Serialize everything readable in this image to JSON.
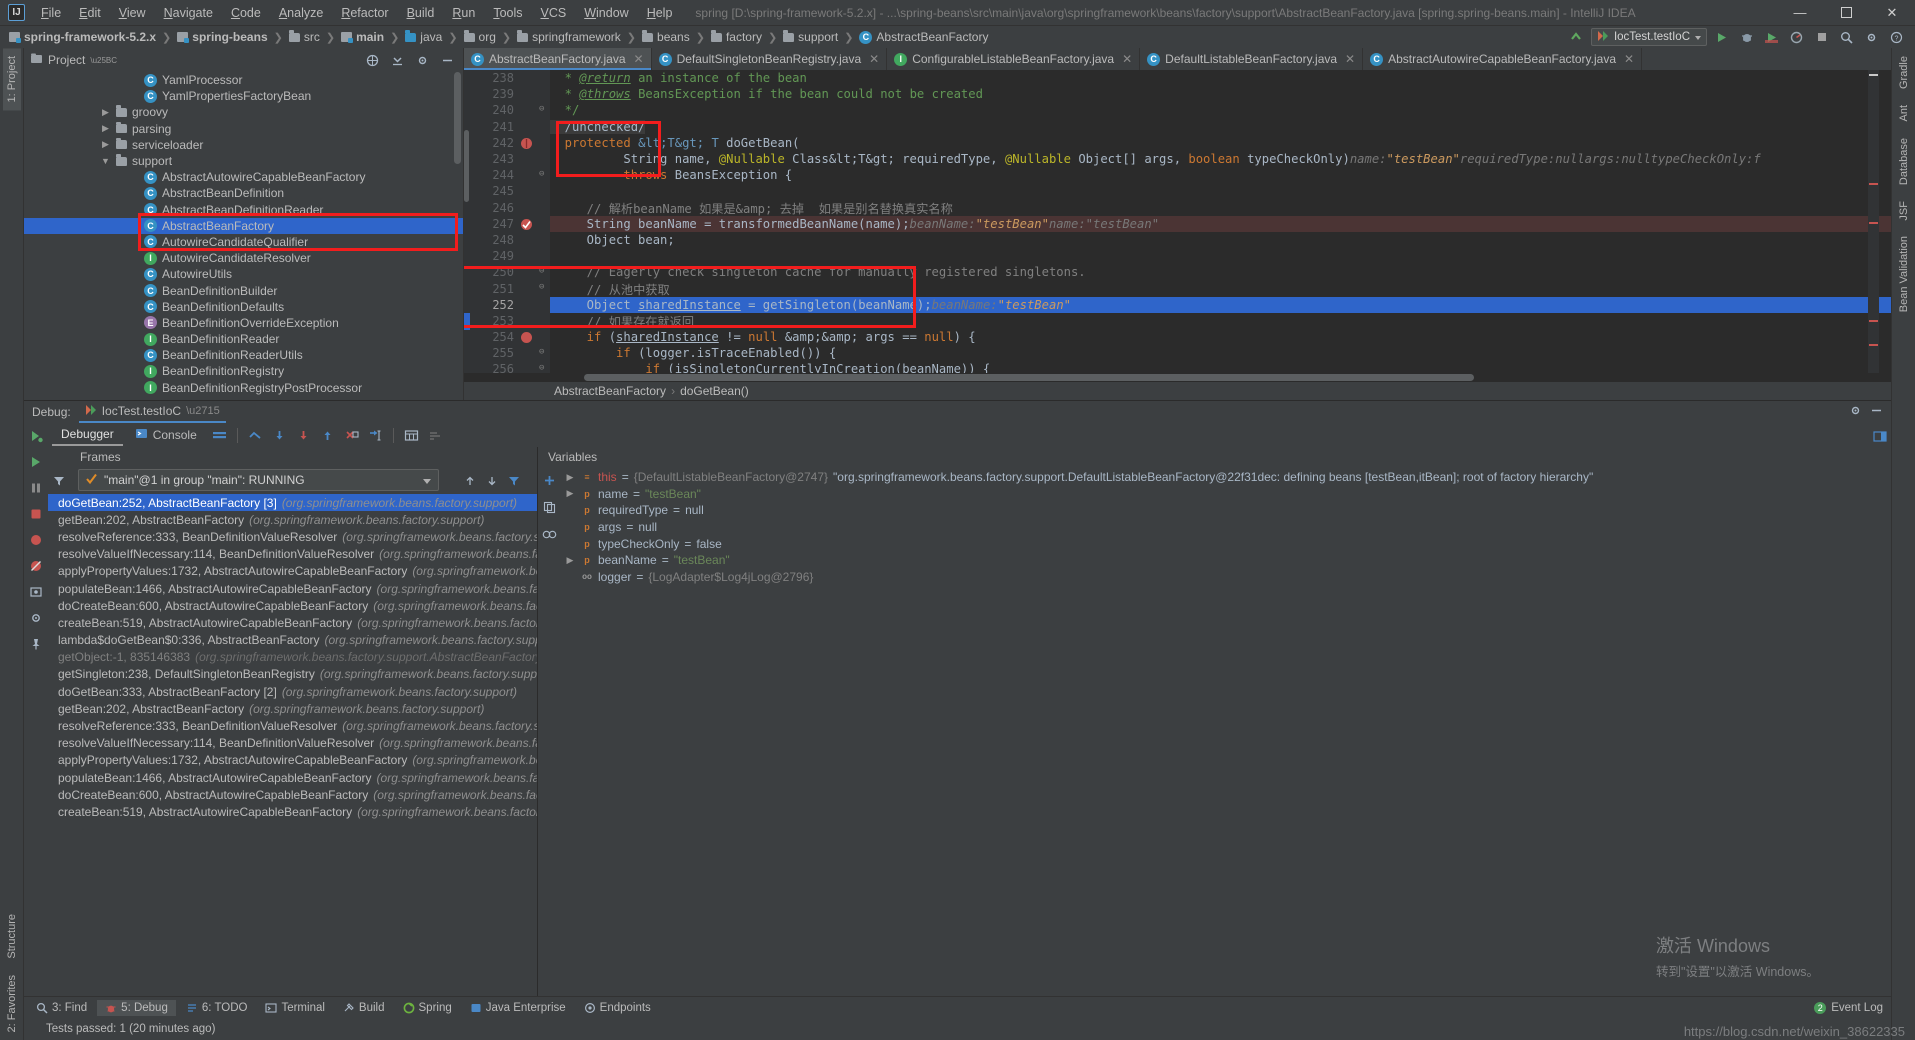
{
  "titlebar": {
    "logo": "IJ",
    "menus": [
      "File",
      "Edit",
      "View",
      "Navigate",
      "Code",
      "Analyze",
      "Refactor",
      "Build",
      "Run",
      "Tools",
      "VCS",
      "Window",
      "Help"
    ],
    "window_title": "spring [D:\\spring-framework-5.2.x] - ...\\spring-beans\\src\\main\\java\\org\\springframework\\beans\\factory\\support\\AbstractBeanFactory.java [spring.spring-beans.main] - IntelliJ IDEA",
    "minimize": "—",
    "maximize": "☐",
    "close": "✕"
  },
  "navbar": {
    "crumbs": [
      {
        "label": "spring-framework-5.2.x",
        "icon": "module-icon",
        "bold": true
      },
      {
        "label": "spring-beans",
        "icon": "module-icon",
        "bold": true
      },
      {
        "label": "src",
        "icon": "folder-icon",
        "bold": false
      },
      {
        "label": "main",
        "icon": "module-icon",
        "bold": true
      },
      {
        "label": "java",
        "icon": "folder-blue-icon",
        "bold": false
      },
      {
        "label": "org",
        "icon": "folder-icon",
        "bold": false
      },
      {
        "label": "springframework",
        "icon": "folder-icon",
        "bold": false
      },
      {
        "label": "beans",
        "icon": "folder-icon",
        "bold": false
      },
      {
        "label": "factory",
        "icon": "folder-icon",
        "bold": false
      },
      {
        "label": "support",
        "icon": "folder-icon",
        "bold": false
      },
      {
        "label": "AbstractBeanFactory",
        "icon": "class-icon",
        "bold": false
      }
    ],
    "separator": "❯",
    "run_config": "IocTest.testIoC",
    "run_label": "Run",
    "debug_label": "Debug",
    "coverage_label": "Run with Coverage",
    "profiler_label": "Profiler",
    "stop_label": "Stop",
    "search_label": "Search Everywhere"
  },
  "left_strip": {
    "project_tab": "1: Project",
    "structure_tab": "Structure",
    "favorites_tab": "2: Favorites"
  },
  "right_strip": {
    "gradle_tab": "Gradle",
    "ant_tab": "Ant",
    "database_tab": "Database",
    "jsf_tab": "JSF",
    "bean_validation_tab": "Bean Validation"
  },
  "project_pane": {
    "title": "Project",
    "tree": [
      {
        "label": "YamlProcessor",
        "icon": "class-icon",
        "indent": 7,
        "arrow": "",
        "selected": false
      },
      {
        "label": "YamlPropertiesFactoryBean",
        "icon": "class-icon",
        "indent": 7,
        "arrow": "",
        "selected": false
      },
      {
        "label": "groovy",
        "icon": "folder-icon",
        "indent": 5,
        "arrow": "▶",
        "selected": false
      },
      {
        "label": "parsing",
        "icon": "folder-icon",
        "indent": 5,
        "arrow": "▶",
        "selected": false
      },
      {
        "label": "serviceloader",
        "icon": "folder-icon",
        "indent": 5,
        "arrow": "▶",
        "selected": false
      },
      {
        "label": "support",
        "icon": "folder-icon",
        "indent": 5,
        "arrow": "▼",
        "selected": false
      },
      {
        "label": "AbstractAutowireCapableBeanFactory",
        "icon": "class-icon",
        "indent": 7,
        "arrow": "",
        "selected": false
      },
      {
        "label": "AbstractBeanDefinition",
        "icon": "class-icon",
        "indent": 7,
        "arrow": "",
        "selected": false
      },
      {
        "label": "AbstractBeanDefinitionReader",
        "icon": "class-icon",
        "indent": 7,
        "arrow": "",
        "selected": false
      },
      {
        "label": "AbstractBeanFactory",
        "icon": "class-icon",
        "indent": 7,
        "arrow": "",
        "selected": true
      },
      {
        "label": "AutowireCandidateQualifier",
        "icon": "class-icon",
        "indent": 7,
        "arrow": "",
        "selected": false
      },
      {
        "label": "AutowireCandidateResolver",
        "icon": "interface-icon",
        "indent": 7,
        "arrow": "",
        "selected": false
      },
      {
        "label": "AutowireUtils",
        "icon": "class-icon",
        "indent": 7,
        "arrow": "",
        "selected": false
      },
      {
        "label": "BeanDefinitionBuilder",
        "icon": "class-icon",
        "indent": 7,
        "arrow": "",
        "selected": false
      },
      {
        "label": "BeanDefinitionDefaults",
        "icon": "class-icon",
        "indent": 7,
        "arrow": "",
        "selected": false
      },
      {
        "label": "BeanDefinitionOverrideException",
        "icon": "enum-icon",
        "indent": 7,
        "arrow": "",
        "selected": false
      },
      {
        "label": "BeanDefinitionReader",
        "icon": "interface-icon",
        "indent": 7,
        "arrow": "",
        "selected": false
      },
      {
        "label": "BeanDefinitionReaderUtils",
        "icon": "class-icon",
        "indent": 7,
        "arrow": "",
        "selected": false
      },
      {
        "label": "BeanDefinitionRegistry",
        "icon": "interface-icon",
        "indent": 7,
        "arrow": "",
        "selected": false
      },
      {
        "label": "BeanDefinitionRegistryPostProcessor",
        "icon": "interface-icon",
        "indent": 7,
        "arrow": "",
        "selected": false
      }
    ]
  },
  "editor": {
    "tabs": [
      {
        "label": "AbstractBeanFactory.java",
        "icon": "class-icon",
        "active": true
      },
      {
        "label": "DefaultSingletonBeanRegistry.java",
        "icon": "class-icon",
        "active": false
      },
      {
        "label": "ConfigurableListableBeanFactory.java",
        "icon": "interface-icon",
        "active": false
      },
      {
        "label": "DefaultListableBeanFactory.java",
        "icon": "class-icon",
        "active": false
      },
      {
        "label": "AbstractAutowireCapableBeanFactory.java",
        "icon": "class-icon",
        "active": false
      }
    ],
    "breadcrumb": [
      "AbstractBeanFactory",
      "doGetBean()"
    ],
    "breadcrumb_sep": "›",
    "lines": [
      {
        "num": "238",
        "text": " * @return an instance of the bean"
      },
      {
        "num": "239",
        "text": " * @throws BeansException if the bean could not be created"
      },
      {
        "num": "240",
        "text": " */"
      },
      {
        "num": "241",
        "text": "/unchecked/"
      },
      {
        "num": "242",
        "text": "protected <T> T doGetBean("
      },
      {
        "num": "243",
        "text": "        String name, @Nullable Class<T> requiredType, @Nullable Object[] args, boolean typeCheckOnly)"
      },
      {
        "num": "244",
        "text": "        throws BeansException {"
      },
      {
        "num": "245",
        "text": ""
      },
      {
        "num": "246",
        "text": "    // 解析beanName 如果是& 去掉  如果是别名替换真实名称"
      },
      {
        "num": "247",
        "text": "    String beanName = transformedBeanName(name);"
      },
      {
        "num": "248",
        "text": "    Object bean;"
      },
      {
        "num": "249",
        "text": ""
      },
      {
        "num": "250",
        "text": "    // Eagerly check singleton cache for manually registered singletons."
      },
      {
        "num": "251",
        "text": "    // 从池中获取"
      },
      {
        "num": "252",
        "text": "    Object sharedInstance = getSingleton(beanName);"
      },
      {
        "num": "253",
        "text": "    // 如果存在就返回"
      },
      {
        "num": "254",
        "text": "    if (sharedInstance != null && args == null) {"
      },
      {
        "num": "255",
        "text": "        if (logger.isTraceEnabled()) {"
      },
      {
        "num": "256",
        "text": "            if (isSingletonCurrentlyInCreation(beanName)) {"
      }
    ],
    "hints": {
      "l243_name": "name:",
      "l243_name_val": "\"testBean\"",
      "l243_reqtype": "requiredType:",
      "l243_reqtype_val": "null",
      "l243_args": "args:",
      "l243_args_val": "null",
      "l243_typecheck": "typeCheckOnly:",
      "l243_typecheck_val": "f",
      "l247_beanname": "beanName:",
      "l247_beanname_val": "\"testBean\"",
      "l247_name": "name:",
      "l247_name_val": "\"testBean\"",
      "l252_beanname": "beanName:",
      "l252_beanname_val": "\"testBean\""
    }
  },
  "debug_panel": {
    "label": "Debug:",
    "session": "IocTest.testIoC",
    "tabs": [
      {
        "label": "Debugger",
        "active": true
      },
      {
        "label": "Console",
        "active": false
      }
    ],
    "toolbar_titles": [
      "Show Execution Point",
      "Step Over",
      "Step Into",
      "Force Step Into",
      "Step Out",
      "Drop Frame",
      "Run to Cursor",
      "Evaluate Expression",
      "Settings"
    ],
    "frames_header": "Frames",
    "thread": "\"main\"@1 in group \"main\": RUNNING",
    "frames": [
      {
        "method": "doGetBean:252, AbstractBeanFactory",
        "pkg": "(org.springframework.beans.factory.support)",
        "suffix": " [3]",
        "selected": true,
        "dim": false
      },
      {
        "method": "getBean:202, AbstractBeanFactory",
        "pkg": "(org.springframework.beans.factory.support)",
        "suffix": "",
        "selected": false,
        "dim": false
      },
      {
        "method": "resolveReference:333, BeanDefinitionValueResolver",
        "pkg": "(org.springframework.beans.factory.support)",
        "suffix": "",
        "selected": false,
        "dim": false
      },
      {
        "method": "resolveValueIfNecessary:114, BeanDefinitionValueResolver",
        "pkg": "(org.springframework.beans.factory.support)",
        "suffix": "",
        "selected": false,
        "dim": false
      },
      {
        "method": "applyPropertyValues:1732, AbstractAutowireCapableBeanFactory",
        "pkg": "(org.springframework.beans.f",
        "suffix": "",
        "selected": false,
        "dim": false
      },
      {
        "method": "populateBean:1466, AbstractAutowireCapableBeanFactory",
        "pkg": "(org.springframework.beans.factory",
        "suffix": "",
        "selected": false,
        "dim": false
      },
      {
        "method": "doCreateBean:600, AbstractAutowireCapableBeanFactory",
        "pkg": "(org.springframework.beans.factory.",
        "suffix": "",
        "selected": false,
        "dim": false
      },
      {
        "method": "createBean:519, AbstractAutowireCapableBeanFactory",
        "pkg": "(org.springframework.beans.factory.sup",
        "suffix": "",
        "selected": false,
        "dim": false
      },
      {
        "method": "lambda$doGetBean$0:336, AbstractBeanFactory",
        "pkg": "(org.springframework.beans.factory.support)",
        "suffix": "",
        "selected": false,
        "dim": false
      },
      {
        "method": "getObject:-1, 835146383",
        "pkg": "(org.springframework.beans.factory.support.AbstractBeanFactory$$La",
        "suffix": "",
        "selected": false,
        "dim": true
      },
      {
        "method": "getSingleton:238, DefaultSingletonBeanRegistry",
        "pkg": "(org.springframework.beans.factory.support)",
        "suffix": "",
        "selected": false,
        "dim": false
      },
      {
        "method": "doGetBean:333, AbstractBeanFactory",
        "pkg": "(org.springframework.beans.factory.support)",
        "suffix": " [2]",
        "selected": false,
        "dim": false
      },
      {
        "method": "getBean:202, AbstractBeanFactory",
        "pkg": "(org.springframework.beans.factory.support)",
        "suffix": "",
        "selected": false,
        "dim": false
      },
      {
        "method": "resolveReference:333, BeanDefinitionValueResolver",
        "pkg": "(org.springframework.beans.factory.suppor",
        "suffix": "",
        "selected": false,
        "dim": false
      },
      {
        "method": "resolveValueIfNecessary:114, BeanDefinitionValueResolver",
        "pkg": "(org.springframework.beans.factory.su",
        "suffix": "",
        "selected": false,
        "dim": false
      },
      {
        "method": "applyPropertyValues:1732, AbstractAutowireCapableBeanFactory",
        "pkg": "(org.springframework.beans.f",
        "suffix": "",
        "selected": false,
        "dim": false
      },
      {
        "method": "populateBean:1466, AbstractAutowireCapableBeanFactory",
        "pkg": "(org.springframework.beans.factory.",
        "suffix": "",
        "selected": false,
        "dim": false
      },
      {
        "method": "doCreateBean:600, AbstractAutowireCapableBeanFactory",
        "pkg": "(org.springframework.beans.factory.s",
        "suffix": "",
        "selected": false,
        "dim": false
      },
      {
        "method": "createBean:519, AbstractAutowireCapableBeanFactory",
        "pkg": "(org.springframework.beans.factory.sup",
        "suffix": "",
        "selected": false,
        "dim": false
      }
    ],
    "variables_header": "Variables",
    "variables": [
      {
        "tri": "▶",
        "badge": "≡",
        "name": "this",
        "namered": true,
        "eq": "=",
        "id": "{DefaultListableBeanFactory@2747}",
        "val": "\"org.springframework.beans.factory.support.DefaultListableBeanFactory@22f31dec: defining beans [testBean,itBean]; root of factory hierarchy\"",
        "hasid": true
      },
      {
        "tri": "▶",
        "badge": "p",
        "name": "name",
        "namered": false,
        "eq": "=",
        "id": "",
        "val": "\"testBean\"",
        "hasid": false,
        "strval": true
      },
      {
        "tri": "",
        "badge": "p",
        "name": "requiredType",
        "namered": false,
        "eq": "=",
        "id": "",
        "val": "null",
        "hasid": false
      },
      {
        "tri": "",
        "badge": "p",
        "name": "args",
        "namered": false,
        "eq": "=",
        "id": "",
        "val": "null",
        "hasid": false
      },
      {
        "tri": "",
        "badge": "p",
        "name": "typeCheckOnly",
        "namered": false,
        "eq": "=",
        "id": "",
        "val": "false",
        "hasid": false
      },
      {
        "tri": "▶",
        "badge": "p",
        "name": "beanName",
        "namered": false,
        "eq": "=",
        "id": "",
        "val": "\"testBean\"",
        "hasid": false,
        "strval": true
      },
      {
        "tri": "",
        "badge": "oo",
        "name": "logger",
        "namered": false,
        "eq": "=",
        "id": "{LogAdapter$Log4jLog@2796}",
        "val": "",
        "hasid": true
      }
    ]
  },
  "tool_windows": {
    "items": [
      {
        "label": "3: Find",
        "icon": "search-icon",
        "active": false
      },
      {
        "label": "5: Debug",
        "icon": "bug-icon",
        "active": true
      },
      {
        "label": "6: TODO",
        "icon": "todo-icon",
        "active": false
      },
      {
        "label": "Terminal",
        "icon": "terminal-icon",
        "active": false
      },
      {
        "label": "Build",
        "icon": "build-icon",
        "active": false
      },
      {
        "label": "Spring",
        "icon": "spring-icon",
        "active": false
      },
      {
        "label": "Java Enterprise",
        "icon": "java-ee-icon",
        "active": false
      },
      {
        "label": "Endpoints",
        "icon": "endpoints-icon",
        "active": false
      }
    ],
    "event_log": "Event Log"
  },
  "statusbar": {
    "message": "Tests passed: 1 (20 minutes ago)",
    "url_overlay": "https://blog.csdn.net/weixin_38622335"
  },
  "watermark": {
    "line1": "激活 Windows",
    "line2": "转到\"设置\"以激活 Windows。"
  },
  "colors": {
    "accent_blue": "#2f65ca",
    "selection": "#2f65ca",
    "annotation_red": "#f21d1d",
    "editor_bg": "#2b2b2b",
    "chrome_bg": "#3c3f41",
    "string_green": "#6a8759",
    "keyword_orange": "#cc7832"
  }
}
